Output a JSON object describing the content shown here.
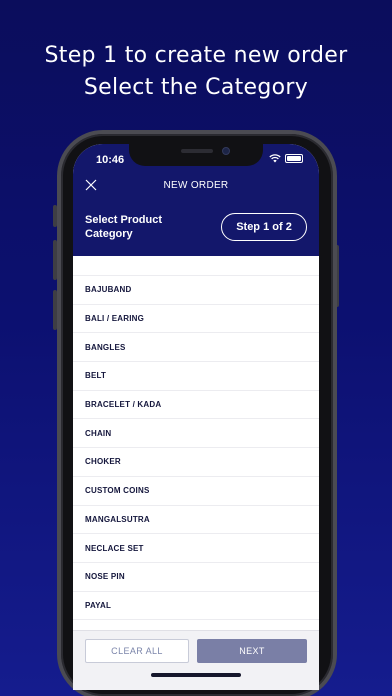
{
  "promo": {
    "line1": "Step 1 to create new order",
    "line2": "Select the Category"
  },
  "status_bar": {
    "time": "10:46",
    "icons": [
      "wifi-icon",
      "battery-icon"
    ]
  },
  "header": {
    "close_icon": "close-icon",
    "title": "NEW ORDER",
    "section_label": "Select Product Category",
    "step": "Step 1 of 2"
  },
  "categories": [
    "BAJUBAND",
    "BALI / EARING",
    "BANGLES",
    "BELT",
    "BRACELET / KADA",
    "CHAIN",
    "CHOKER",
    "CUSTOM COINS",
    "MANGALSUTRA",
    "NECLACE SET",
    "NOSE PIN",
    "PAYAL"
  ],
  "footer": {
    "clear_label": "CLEAR ALL",
    "next_label": "NEXT"
  },
  "colors": {
    "background_top": "#0b0d5c",
    "background_bottom": "#151c8e",
    "header_bg": "#13176b",
    "next_button": "#7a7fa6",
    "clear_text": "#7b85aa"
  }
}
